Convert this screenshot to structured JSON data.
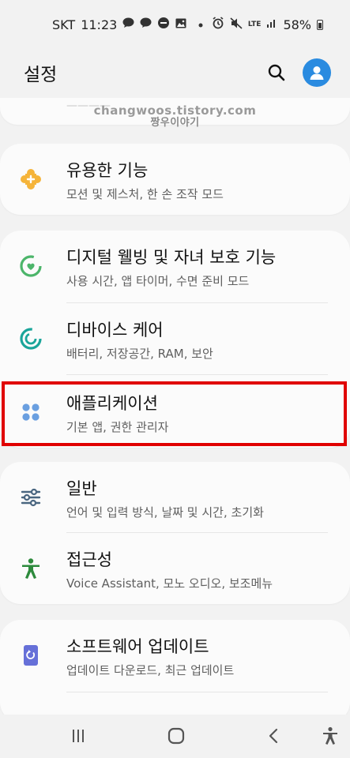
{
  "status_bar": {
    "carrier": "SKT",
    "time": "11:23",
    "battery": "58%",
    "icons": [
      "chat-icon",
      "talk-icon",
      "sale-icon",
      "image-icon",
      "dot-icon",
      "alarm-icon",
      "mute-icon",
      "lte-icon",
      "signal-icon",
      "battery-icon"
    ],
    "lte": "LTE"
  },
  "header": {
    "title": "설정",
    "search_icon": "search-icon",
    "avatar_icon": "avatar-icon",
    "accent": "#2a8be0"
  },
  "watermark": {
    "line1": "changwoos.tistory.com",
    "line2": "짱우이야기"
  },
  "cards": [
    {
      "items": [
        {
          "title": "유용한 기능",
          "subtitle": "모션 및 제스처, 한 손 조작 모드",
          "icon": "puzzle-plus-icon",
          "color": "#f5b43a"
        }
      ]
    },
    {
      "items": [
        {
          "title": "디지털 웰빙 및 자녀 보호 기능",
          "subtitle": "사용 시간, 앱 타이머, 수면 준비 모드",
          "icon": "wellbeing-icon",
          "color": "#4cb56a"
        },
        {
          "title": "디바이스 케어",
          "subtitle": "배터리, 저장공간, RAM, 보안",
          "icon": "device-care-icon",
          "color": "#1aa59a"
        },
        {
          "title": "애플리케이션",
          "subtitle": "기본 앱, 권한 관리자",
          "icon": "apps-icon",
          "color": "#6a9fe0"
        }
      ]
    },
    {
      "items": [
        {
          "title": "일반",
          "subtitle": "언어 및 입력 방식, 날짜 및 시간, 초기화",
          "icon": "sliders-icon",
          "color": "#4a6680"
        },
        {
          "title": "접근성",
          "subtitle": "Voice Assistant, 모노 오디오, 보조메뉴",
          "icon": "accessibility-icon",
          "color": "#2d8a3c"
        }
      ]
    },
    {
      "items": [
        {
          "title": "소프트웨어 업데이트",
          "subtitle": "업데이트 다운로드, 최근 업데이트",
          "icon": "software-update-icon",
          "color": "#6670d8"
        }
      ]
    }
  ],
  "highlight_color": "#e00000",
  "nav": {
    "recents_icon": "recents-icon",
    "home_icon": "home-icon",
    "back_icon": "back-icon",
    "accessibility_icon": "accessibility-shortcut-icon"
  }
}
